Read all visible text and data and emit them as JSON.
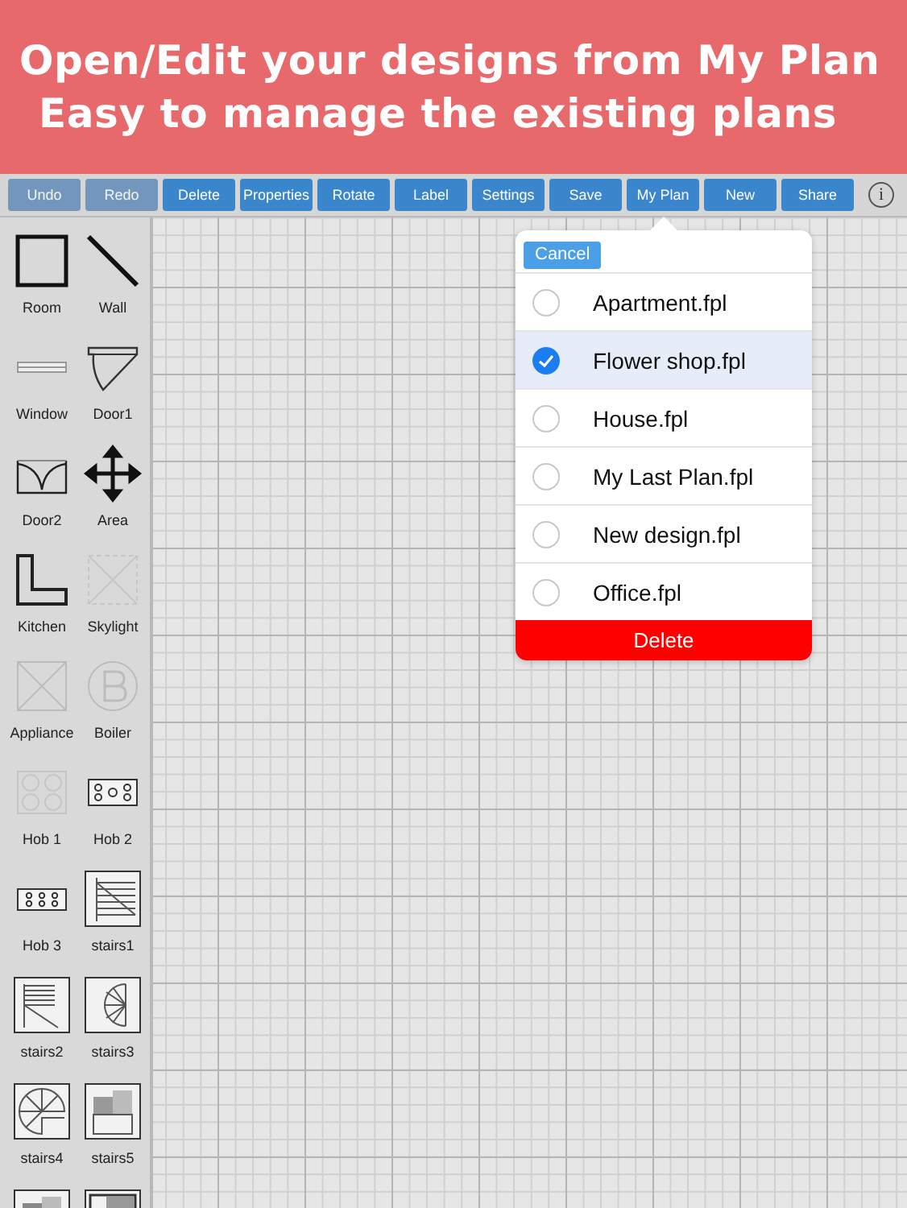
{
  "banner": {
    "lines": [
      "Open/Edit your designs from My Plan",
      "Easy to manage the existing plans"
    ]
  },
  "toolbar": {
    "buttons": [
      {
        "label": "Undo",
        "disabled": true
      },
      {
        "label": "Redo",
        "disabled": true
      },
      {
        "label": "Delete",
        "disabled": false
      },
      {
        "label": "Properties",
        "disabled": false
      },
      {
        "label": "Rotate",
        "disabled": false
      },
      {
        "label": "Label",
        "disabled": false
      },
      {
        "label": "Settings",
        "disabled": false
      },
      {
        "label": "Save",
        "disabled": false
      },
      {
        "label": "My Plan",
        "disabled": false
      },
      {
        "label": "New",
        "disabled": false
      },
      {
        "label": "Share",
        "disabled": false
      }
    ],
    "info": "i"
  },
  "sidebar": {
    "items": [
      {
        "kind": "room",
        "label": "Room",
        "faded": false
      },
      {
        "kind": "wall",
        "label": "Wall",
        "faded": false
      },
      {
        "kind": "window",
        "label": "Window",
        "faded": false
      },
      {
        "kind": "door1",
        "label": "Door1",
        "faded": false
      },
      {
        "kind": "door2",
        "label": "Door2",
        "faded": false
      },
      {
        "kind": "area",
        "label": "Area",
        "faded": false
      },
      {
        "kind": "kitchen",
        "label": "Kitchen",
        "faded": false
      },
      {
        "kind": "skylight",
        "label": "Skylight",
        "faded": true
      },
      {
        "kind": "appliance",
        "label": "Appliance",
        "faded": true
      },
      {
        "kind": "boiler",
        "label": "Boiler",
        "faded": true
      },
      {
        "kind": "hob1",
        "label": "Hob 1",
        "faded": true
      },
      {
        "kind": "hob2",
        "label": "Hob 2",
        "faded": false
      },
      {
        "kind": "hob3",
        "label": "Hob 3",
        "faded": false
      },
      {
        "kind": "stairs1",
        "label": "stairs1",
        "faded": false
      },
      {
        "kind": "stairs2",
        "label": "stairs2",
        "faded": false
      },
      {
        "kind": "stairs3",
        "label": "stairs3",
        "faded": false
      },
      {
        "kind": "stairs4",
        "label": "stairs4",
        "faded": false
      },
      {
        "kind": "stairs5",
        "label": "stairs5",
        "faded": false
      },
      {
        "kind": "stairs6",
        "faded": false
      },
      {
        "kind": "stairs7",
        "faded": false
      }
    ]
  },
  "plan_menu": {
    "cancel": "Cancel",
    "files": [
      {
        "name": "Apartment.fpl",
        "selected": false
      },
      {
        "name": "Flower shop.fpl",
        "selected": true
      },
      {
        "name": "House.fpl",
        "selected": false
      },
      {
        "name": "My Last Plan.fpl",
        "selected": false
      },
      {
        "name": "New design.fpl",
        "selected": false
      },
      {
        "name": "Office.fpl",
        "selected": false
      }
    ],
    "delete": "Delete"
  }
}
